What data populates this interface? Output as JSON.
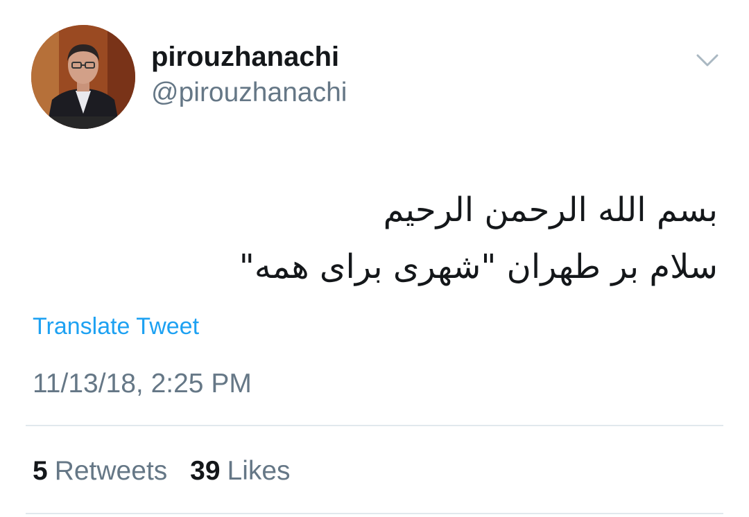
{
  "user": {
    "display_name": "pirouzhanachi",
    "handle": "@pirouzhanachi",
    "avatar_icon": "profile-photo"
  },
  "tweet": {
    "lines": [
      "بسم الله الرحمن الرحیم",
      "سلام بر طهران \"شهری برای همه\""
    ],
    "language_direction": "rtl"
  },
  "actions": {
    "translate_label": "Translate Tweet",
    "menu_icon": "chevron-down-icon"
  },
  "meta": {
    "timestamp": "11/13/18, 2:25 PM"
  },
  "stats": {
    "retweets_count": "5",
    "retweets_label": "Retweets",
    "likes_count": "39",
    "likes_label": "Likes"
  },
  "colors": {
    "link": "#1da1f2",
    "secondary_text": "#657786",
    "primary_text": "#14171a",
    "divider": "#e1e8ed"
  }
}
